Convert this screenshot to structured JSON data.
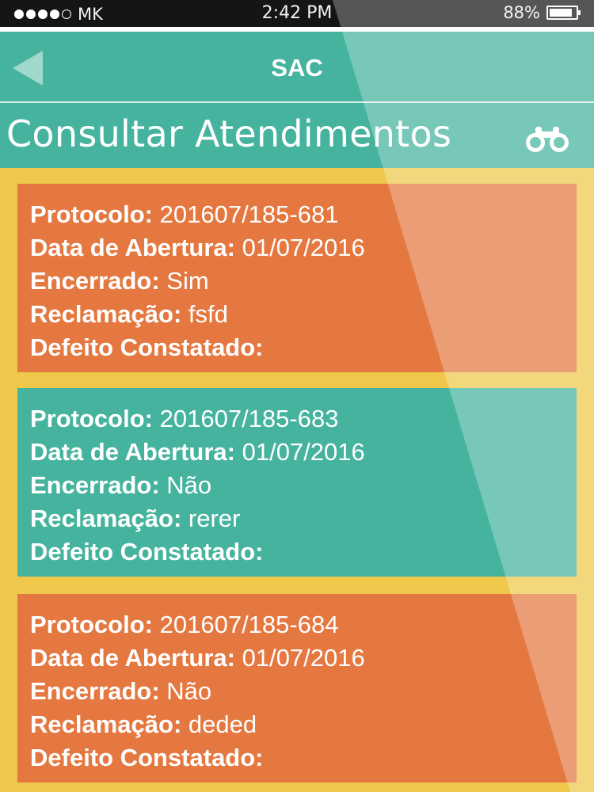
{
  "status_bar": {
    "carrier": "MK",
    "time": "2:42 PM",
    "battery_percent_text": "88%",
    "battery_level": 0.88
  },
  "navbar": {
    "title": "SAC",
    "back_icon": "back-arrow-icon"
  },
  "subheader": {
    "title": "Consultar Atendimentos",
    "search_icon": "binoculars-icon"
  },
  "labels": {
    "protocolo": "Protocolo:",
    "data_abertura": "Data de Abertura:",
    "encerrado": "Encerrado:",
    "reclamacao": "Reclamação:",
    "defeito": "Defeito Constatado:"
  },
  "atendimentos": [
    {
      "protocolo": "201607/185-681",
      "data_abertura": "01/07/2016",
      "encerrado": "Sim",
      "reclamacao": "fsfd",
      "defeito": "",
      "color": "#e47840"
    },
    {
      "protocolo": "201607/185-683",
      "data_abertura": "01/07/2016",
      "encerrado": "Não",
      "reclamacao": "rerer",
      "defeito": "",
      "color": "#45b39e"
    },
    {
      "protocolo": "201607/185-684",
      "data_abertura": "01/07/2016",
      "encerrado": "Não",
      "reclamacao": "deded",
      "defeito": "",
      "color": "#e47840"
    }
  ],
  "colors": {
    "teal": "#45b39e",
    "orange": "#e47840",
    "yellow": "#efc84b"
  }
}
